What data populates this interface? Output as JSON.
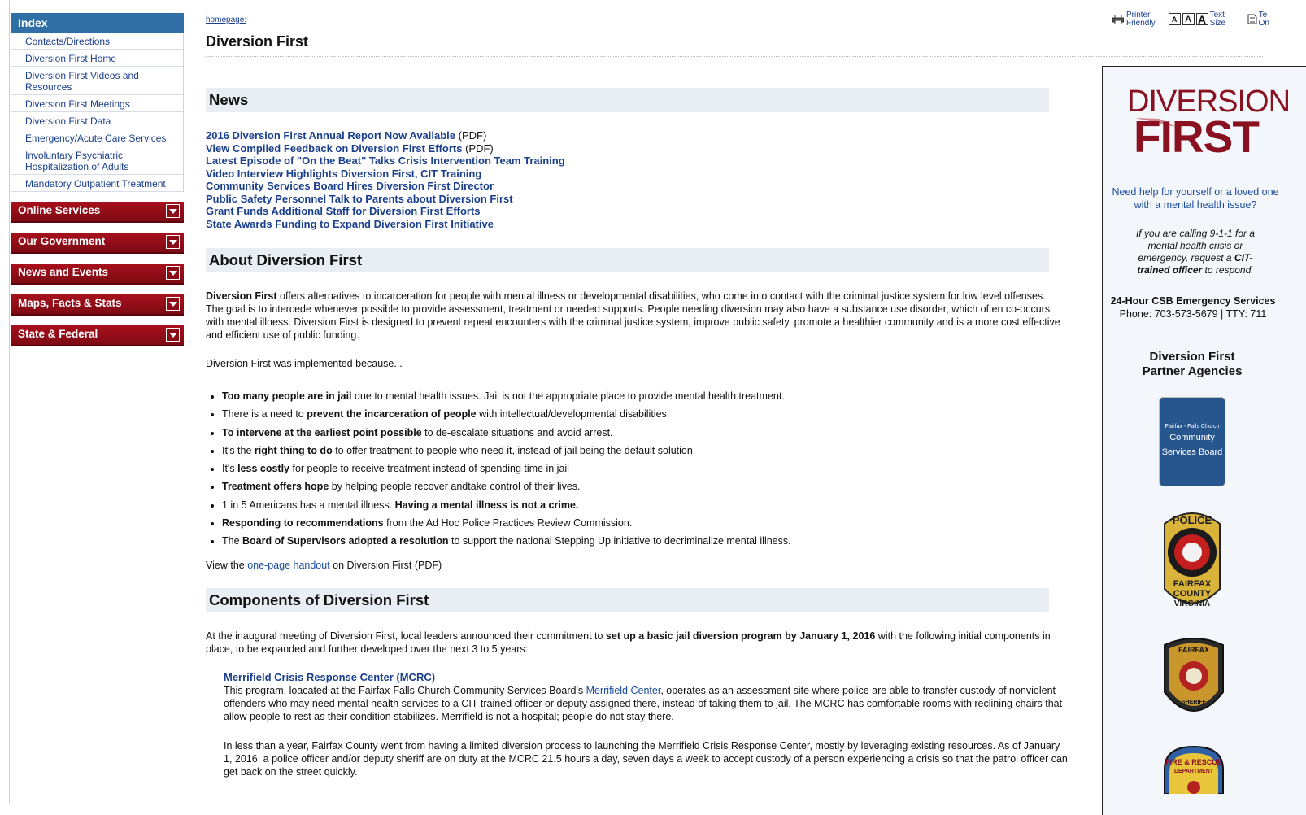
{
  "sidebar": {
    "index_title": "Index",
    "index_items": [
      {
        "label": "Contacts/Directions"
      },
      {
        "label": "Diversion First Home"
      },
      {
        "label": "Diversion First Videos and Resources"
      },
      {
        "label": "Diversion First Meetings"
      },
      {
        "label": "Diversion First Data"
      },
      {
        "label": "Emergency/Acute Care Services"
      },
      {
        "label": "Involuntary Psychiatric Hospitalization of Adults"
      },
      {
        "label": "Mandatory Outpatient Treatment"
      }
    ],
    "menus": [
      "Online Services",
      "Our Government",
      "News and Events",
      "Maps, Facts & Stats",
      "State & Federal"
    ]
  },
  "breadcrumb": "homepage:",
  "page_title": "Diversion First",
  "toolbar": {
    "printer_1": "Printer",
    "printer_2": "Friendly",
    "size_a": "A",
    "text_size_1": "Text",
    "text_size_2": "Size",
    "text_only_1": "Te",
    "text_only_2": "On"
  },
  "news": {
    "heading": "News",
    "items": [
      {
        "link": "2016 Diversion First Annual Report Now Available",
        "suffix": " (PDF)"
      },
      {
        "link": "View Compiled Feedback on Diversion First Efforts",
        "suffix": " (PDF)"
      },
      {
        "link": "Latest Episode of \"On the Beat\" Talks Crisis Intervention Team Training",
        "suffix": ""
      },
      {
        "link": "Video Interview Highlights Diversion First, CIT Training",
        "suffix": ""
      },
      {
        "link": "Community Services Board Hires Diversion First Director",
        "suffix": ""
      },
      {
        "link": "Public Safety Personnel Talk to Parents about Diversion First",
        "suffix": ""
      },
      {
        "link": "Grant Funds Additional Staff for Diversion First Efforts",
        "suffix": ""
      },
      {
        "link": "State Awards Funding to Expand Diversion First Initiative",
        "suffix": ""
      }
    ]
  },
  "about": {
    "heading": "About Diversion First",
    "p1_bold": "Diversion First",
    "p1_rest": " offers alternatives to incarceration for people with mental illness or developmental disabilities, who come into contact with the criminal justice system for low level offenses. The goal is to intercede whenever possible to provide assessment, treatment or needed supports. People needing diversion may also have a substance use disorder, which often co-occurs with mental illness. Diversion First is designed to prevent repeat encounters with the criminal justice system, improve public safety, promote a healthier community and is a more cost effective and efficient use of public funding.",
    "p2": "Diversion First was implemented because...",
    "bullets": [
      {
        "a": "",
        "b": "Too many people are in jail",
        "c": " due to mental health issues. Jail is not the appropriate place to provide mental health treatment."
      },
      {
        "a": "There is a need to ",
        "b": "prevent the incarceration of people",
        "c": " with intellectual/developmental disabilities."
      },
      {
        "a": "",
        "b": "To intervene at the earliest point possible",
        "c": " to de-escalate situations and avoid arrest."
      },
      {
        "a": "It's the ",
        "b": "right thing to do",
        "c": " to offer treatment to people who need it, instead of jail being the default solution"
      },
      {
        "a": "It's ",
        "b": "less costly",
        "c": " for people to receive treatment instead of spending time in jail"
      },
      {
        "a": "",
        "b": "Treatment offers hope",
        "c": " by helping people recover andtake control of their lives."
      },
      {
        "a": "1 in 5 Americans has a mental illness. ",
        "b": "Having a mental illness is not a crime.",
        "c": ""
      },
      {
        "a": "",
        "b": "Responding to recommendations",
        "c": " from the Ad Hoc Police Practices Review Commission."
      },
      {
        "a": "The ",
        "b": "Board of Supervisors adopted a resolution",
        "c": " to support the national Stepping Up initiative to decriminalize mental illness."
      }
    ],
    "handout_pre": "View the ",
    "handout_link": "one-page handout",
    "handout_post": " on Diversion First (PDF)"
  },
  "components": {
    "heading": "Components of Diversion First",
    "p_pre": "At the inaugural meeting of Diversion First, local leaders announced their commitment to ",
    "p_bold": "set up a basic jail diversion program by January 1, 2016",
    "p_post": " with the following initial components in place, to be expanded and further developed over the next 3 to 5 years:",
    "mcrc_title": "Merrifield Crisis Response Center (MCRC)",
    "mcrc_pre": "This program, loacated at the Fairfax-Falls Church Community Services Board's ",
    "mcrc_link": "Merrifield Center",
    "mcrc_post": ", operates as an assessment site where police are able to transfer custody of nonviolent offenders who may need mental health services to a CIT-trained officer or deputy assigned there, instead of taking them to jail. The MCRC has comfortable rooms with reclining chairs that allow people to rest as their condition stabilizes. Merrifield is not a hospital; people do not stay there.",
    "mcrc_p2": "In less than a year, Fairfax County went from having a limited diversion process to launching the Merrifield Crisis Response Center, mostly by leveraging existing resources. As of January 1, 2016, a police officer and/or deputy sheriff are on duty at the MCRC 21.5 hours a day, seven days a week to accept custody of a person experiencing a crisis so that the patrol officer can get back on the street quickly."
  },
  "right_panel": {
    "logo_top": "DIVERSION",
    "logo_bottom": "FIRST",
    "help": "Need help for yourself or a loved one with a mental health issue?",
    "calling_1": "If you are calling 9-1-1 for a mental health crisis or emergency, request a ",
    "calling_bold": "CIT-trained officer",
    "calling_2": " to respond.",
    "csb_title": "24-Hour CSB Emergency Services",
    "csb_phone": "Phone: 703-573-5679 | TTY: 711",
    "partners": "Diversion First Partner Agencies",
    "csb_badge_small": "Fairfax - Falls Church",
    "csb_badge_1": "Community",
    "csb_badge_2": "Services Board",
    "police_badge_top": "POLICE",
    "police_badge_bottom_1": "FAIRFAX",
    "police_badge_bottom_2": "COUNTY",
    "police_badge_bottom_3": "VIRGINIA",
    "sheriff_badge_top": "FAIRFAX",
    "sheriff_badge_bottom": "SHERIFF",
    "fire_badge_top": "FIRE & RESCUE",
    "fire_badge_sub": "DEPARTMENT"
  },
  "colors": {
    "index_blue": "#2f6fa6",
    "menu_red": "#8b0c16",
    "link_blue": "#1a3f8c",
    "section_bg": "#e9eef4",
    "logo_red": "#8a1220"
  }
}
